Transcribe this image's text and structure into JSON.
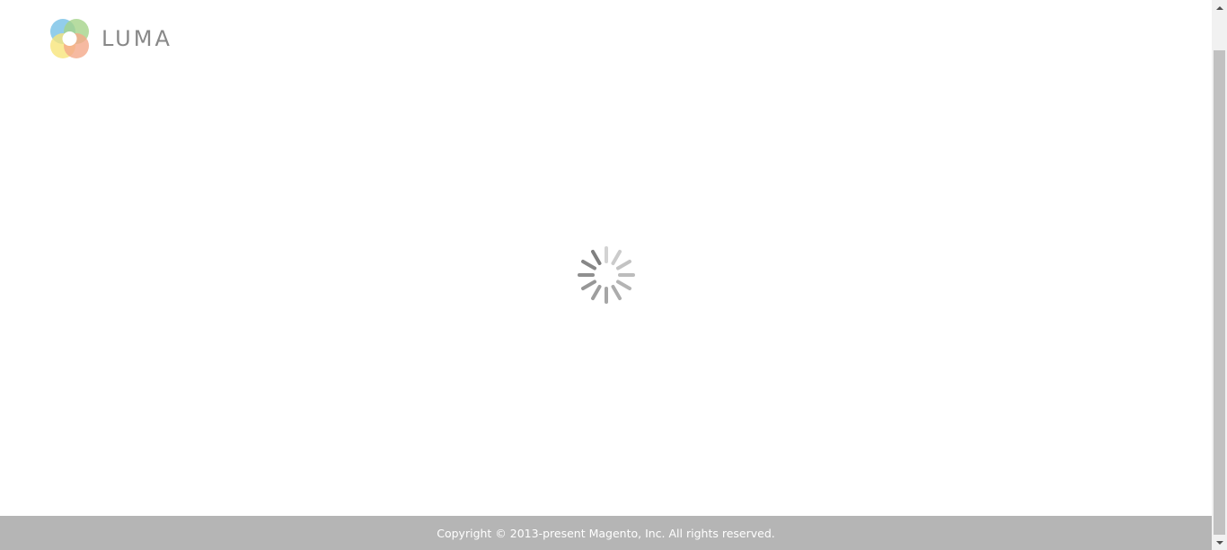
{
  "header": {
    "logo_text": "LUMA",
    "logo_colors": [
      "#7fc4e8",
      "#a5d38a",
      "#f7e57a",
      "#f4a98a"
    ]
  },
  "loader": {
    "icon": "loading-spinner-icon",
    "color": "#808080"
  },
  "footer": {
    "copyright": "Copyright © 2013-present Magento, Inc. All rights reserved.",
    "background": "#b5b5b5"
  },
  "scrollbar": {
    "up_icon": "scroll-up-arrow-icon",
    "down_icon": "scroll-down-arrow-icon"
  }
}
